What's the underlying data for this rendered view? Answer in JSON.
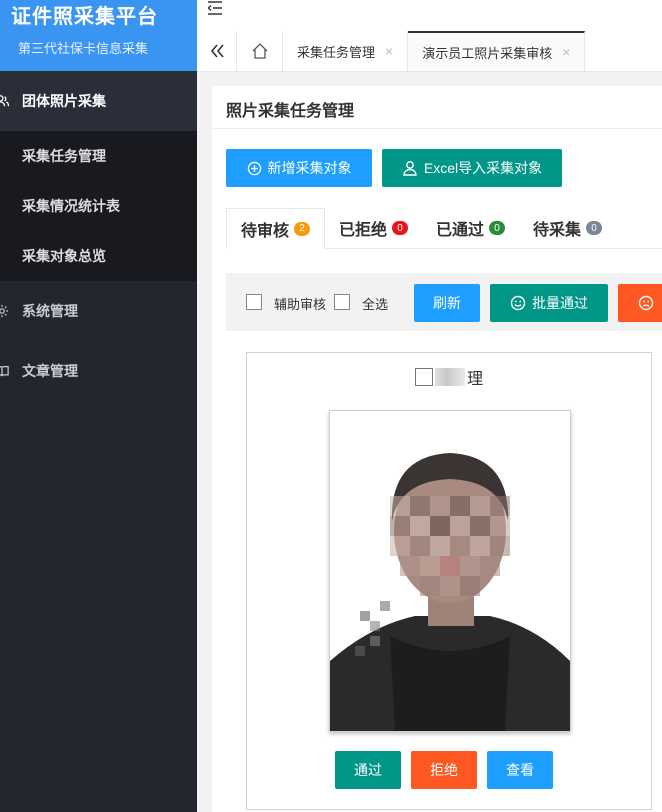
{
  "sidebar": {
    "brand_title": "证件照采集平台",
    "brand_subtitle": "第三代社保卡信息采集",
    "groups": [
      {
        "label": "团体照片采集",
        "icon": "users-icon"
      },
      {
        "label": "系统管理",
        "icon": "gear-icon"
      },
      {
        "label": "文章管理",
        "icon": "book-icon"
      }
    ],
    "sub_items": [
      {
        "label": "采集任务管理"
      },
      {
        "label": "采集情况统计表"
      },
      {
        "label": "采集对象总览"
      }
    ]
  },
  "tabbar": {
    "tabs": [
      {
        "label": "采集任务管理",
        "close": "×"
      },
      {
        "label": "演示员工照片采集审核",
        "close": "×"
      }
    ],
    "back_icon": "double-chevron-left-icon",
    "home_icon": "home-icon"
  },
  "page": {
    "title": "照片采集任务管理",
    "add_label": "新增采集对象",
    "import_label": "Excel导入采集对象"
  },
  "status_tabs": [
    {
      "label": "待审核",
      "count": "2",
      "color": "#f59a0b"
    },
    {
      "label": "已拒绝",
      "count": "0",
      "color": "#e6151d"
    },
    {
      "label": "已通过",
      "count": "0",
      "color": "#2a8c3b"
    },
    {
      "label": "待采集",
      "count": "0",
      "color": "#7a8796"
    }
  ],
  "filter": {
    "assist_label": "辅助审核",
    "select_all_label": "全选",
    "refresh_label": "刷新",
    "batch_pass_label": "批量通过"
  },
  "photo_card": {
    "name_suffix": "理",
    "pass_label": "通过",
    "reject_label": "拒绝",
    "view_label": "查看"
  },
  "colors": {
    "sidebar_bg": "#23262e",
    "brand_bg": "#3a95f2",
    "blue": "#1e9fff",
    "green": "#009688",
    "orange": "#ff5722"
  }
}
